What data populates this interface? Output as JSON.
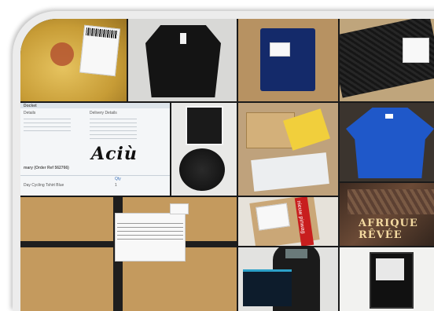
{
  "image": {
    "description_tiles": [
      {
        "key": "yellow-mailer",
        "label_text": ""
      },
      {
        "key": "black-cardigan"
      },
      {
        "key": "blue-packet"
      },
      {
        "key": "black-textured-box"
      },
      {
        "key": "delivery-docket"
      },
      {
        "key": "small-parcels"
      },
      {
        "key": "boxes-with-label"
      },
      {
        "key": "blue-shirt"
      },
      {
        "key": "cardboard-box"
      },
      {
        "key": "wrapped-parcel"
      },
      {
        "key": "afrique-book"
      },
      {
        "key": "person-with-bag"
      },
      {
        "key": "tablet-box"
      }
    ]
  },
  "docket": {
    "title": "Docket",
    "details_label": "Details",
    "delivery_details_label": "Delivery Details",
    "handwriting": "Aciù",
    "summary_label": "mary (Order Ref 562766)",
    "item_line": "Day Cycling Tshirt Blue",
    "qty_header": "Qty",
    "qty_value": "1"
  },
  "wrapped_parcel": {
    "tape_text": "nieuw pinwag"
  },
  "book": {
    "title": "AFRIQUE RÊVÉE"
  },
  "colors": {
    "frame": "#ececec",
    "yellow_mailer": "#d6b24a",
    "blue_shirt": "#1f58c9",
    "cardboard": "#c49a5e"
  }
}
